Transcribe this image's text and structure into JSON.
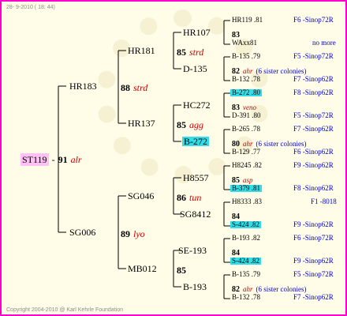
{
  "header": {
    "date": "28- 9-2010 ( 18: 44)"
  },
  "footer": {
    "copyright": "Copyright 2004-2010 @ Karl Kehrle Foundation"
  },
  "root": {
    "id": "ST119",
    "dash": "-",
    "num": "91",
    "race": "alr"
  },
  "gen1": [
    {
      "id": "HR183"
    },
    {
      "id": "SG006",
      "num": "89",
      "race": "lyo"
    }
  ],
  "gen2": [
    {
      "id": "HR181",
      "num": "88",
      "race": "strd"
    },
    {
      "id": "HR137"
    },
    {
      "id": "SG046",
      "num": "86",
      "race": "tun"
    },
    {
      "id": "MB012",
      "num": "85"
    }
  ],
  "gen3": [
    {
      "id": "HR107",
      "num": "85",
      "race": "strd"
    },
    {
      "id": "D-135"
    },
    {
      "id": "HC272",
      "num": "85",
      "race": "agg"
    },
    {
      "id": "B-272"
    },
    {
      "id": "H8557"
    },
    {
      "id": "SG8412"
    },
    {
      "id": "SE-193",
      "num": "85"
    },
    {
      "id": "B-193"
    }
  ],
  "gen4": [
    {
      "line1": "HR119 .81",
      "num": "83",
      "race": "",
      "line3": "WAxx81",
      "src1": "F6 -Sinop72R",
      "src2": "",
      "src3": "no more"
    },
    {
      "line1": "B-135 .79",
      "num": "82",
      "race": "",
      "note": "(6 sister colonies)",
      "line3": "B-132 .78",
      "src1": "F5 -Sinop72R",
      "src2": "",
      "src3": "F7 -Sinop62R"
    },
    {
      "line1": "B-272 .80",
      "num": "83",
      "race": "veno",
      "line3": "D-391 .80",
      "src1": "F8 -Sinop62R",
      "src2": "",
      "src3": "F5 -Sinop72R"
    },
    {
      "line1": "B-265 .78",
      "num": "80",
      "race": "",
      "note": "(6 sister colonies)",
      "line3": "B-129 .77",
      "src1": "F7 -Sinop62R",
      "src2": "",
      "src3": "F6 -Sinop62R"
    },
    {
      "line1": "H8245 .82",
      "num": "85",
      "race": "asp",
      "line3": "B-379 .81",
      "src1": "F9 -Sinop62R",
      "src2": "",
      "src3": "F8 -Sinop62R"
    },
    {
      "line1": "H8333 .83",
      "num": "84",
      "race": "",
      "line3": "S-424 .82",
      "src1": "F1 -8018",
      "src2": "",
      "src3": "F9 -Sinop62R"
    },
    {
      "line1": "B-193 .82",
      "num": "84",
      "race": "",
      "line3": "S-424 .82",
      "src1": "F6 -Sinop72R",
      "src2": "",
      "src3": "F9 -Sinop62R"
    },
    {
      "line1": "B-135 .79",
      "num": "82",
      "race": "",
      "note": "(6 sister colonies)",
      "line3": "B-132 .78",
      "src1": "F5 -Sinop72R",
      "src2": "",
      "src3": "F7 -Sinop62R"
    }
  ],
  "colors": {
    "border": "#ff00cc",
    "highlight": "#33dde8",
    "root_bg": "#ffc0f4",
    "race": "#cc0000",
    "source": "#0000cc"
  }
}
